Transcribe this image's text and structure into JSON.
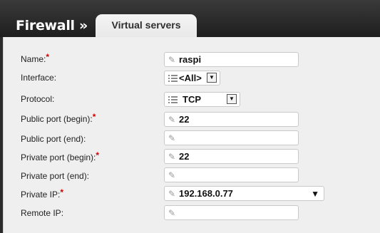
{
  "header": {
    "breadcrumb": "Firewall »",
    "tab_active": "Virtual servers"
  },
  "form": {
    "name": {
      "label": "Name:",
      "required": "*",
      "value": "raspi"
    },
    "interface": {
      "label": "Interface:",
      "value": "<All>"
    },
    "protocol": {
      "label": "Protocol:",
      "value": "TCP"
    },
    "public_port_begin": {
      "label": "Public port (begin):",
      "required": "*",
      "value": "22"
    },
    "public_port_end": {
      "label": "Public port (end):",
      "value": ""
    },
    "private_port_begin": {
      "label": "Private port (begin):",
      "required": "*",
      "value": "22"
    },
    "private_port_end": {
      "label": "Private port (end):",
      "value": ""
    },
    "private_ip": {
      "label": "Private IP:",
      "required": "*",
      "value": "192.168.0.77"
    },
    "remote_ip": {
      "label": "Remote IP:",
      "value": ""
    }
  },
  "icons": {
    "edit": "pencil-icon",
    "list": "list-icon",
    "dropdown": "chevron-down-icon"
  }
}
